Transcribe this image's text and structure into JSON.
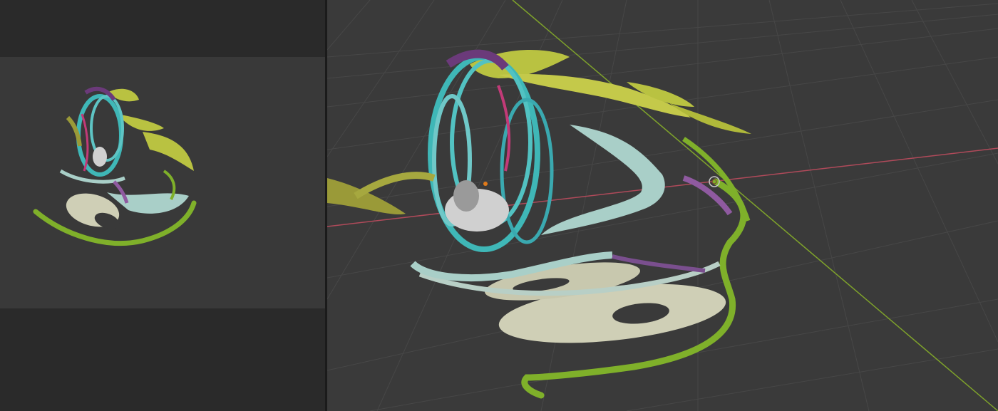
{
  "left_panel": {
    "view": "camera-preview"
  },
  "viewport": {
    "grid": true,
    "axes": {
      "x_color": "#b04a5a",
      "y_color": "#7fa32b"
    }
  },
  "colors": {
    "background_dark": "#2a2a2a",
    "viewport_bg": "#3a3a3a",
    "camera_bg": "#393939",
    "yellow_green": "#b9c241",
    "teal": "#3fb7b7",
    "light_teal": "#a9cfc8",
    "cream": "#cfcfb6",
    "purple": "#6b3a7a",
    "magenta": "#c23a78",
    "green": "#7fb02a",
    "olive": "#9a9a38",
    "gray_white": "#d0d0d0"
  }
}
